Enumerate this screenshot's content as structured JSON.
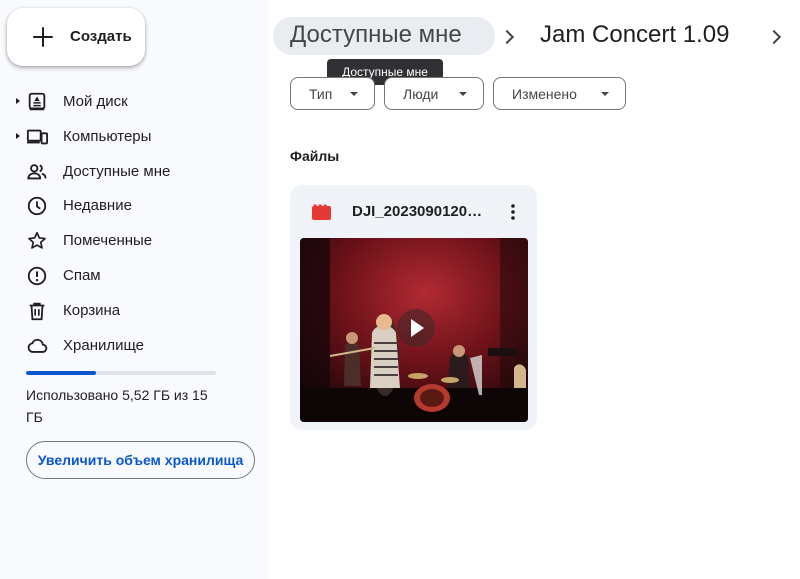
{
  "sidebar": {
    "create_label": "Создать",
    "items": [
      {
        "label": "Мой диск",
        "icon": "my-drive-icon",
        "expandable": true
      },
      {
        "label": "Компьютеры",
        "icon": "computers-icon",
        "expandable": true
      },
      {
        "label": "Доступные мне",
        "icon": "shared-people-icon",
        "expandable": false
      },
      {
        "label": "Недавние",
        "icon": "clock-icon",
        "expandable": false
      },
      {
        "label": "Помеченные",
        "icon": "star-icon",
        "expandable": false
      },
      {
        "label": "Спам",
        "icon": "spam-icon",
        "expandable": false
      },
      {
        "label": "Корзина",
        "icon": "trash-icon",
        "expandable": false
      },
      {
        "label": "Хранилище",
        "icon": "cloud-icon",
        "expandable": false
      }
    ],
    "storage": {
      "used_fraction": 0.368,
      "text": "Использовано 5,52 ГБ из 15 ГБ",
      "upgrade_label": "Увеличить объем хранилища"
    }
  },
  "breadcrumb": {
    "items": [
      "Доступные мне",
      "Jam Concert 1.09"
    ],
    "tooltip": "Доступные мне"
  },
  "filters": [
    {
      "label": "Тип"
    },
    {
      "label": "Люди"
    },
    {
      "label": "Изменено"
    }
  ],
  "files_section": {
    "title": "Файлы",
    "files": [
      {
        "name": "DJI_2023090120…",
        "type_icon": "video-file-icon",
        "menu_icon": "more-vert-icon"
      }
    ]
  },
  "colors": {
    "accent": "#0b57d0",
    "sidebar_bg": "#f8fafd",
    "card_bg": "#f0f4f9",
    "video_icon": "#e53935"
  }
}
